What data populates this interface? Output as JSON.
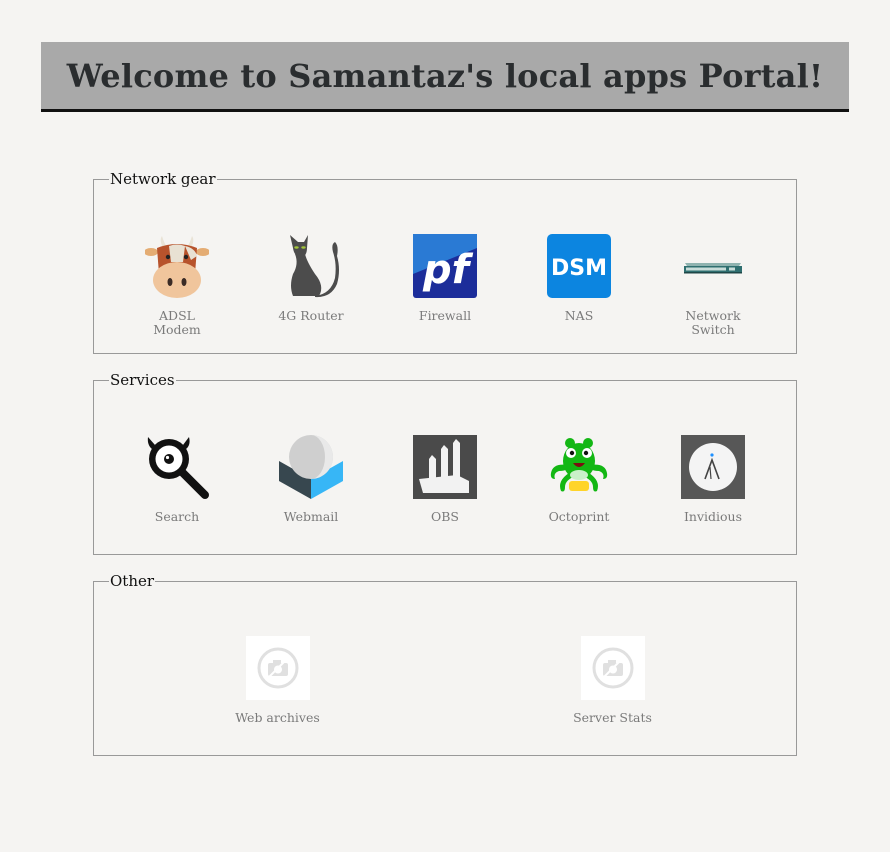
{
  "header": {
    "title": "Welcome to Samantaz's local apps Portal!"
  },
  "sections": [
    {
      "legend": "Network gear",
      "apps": [
        {
          "label": "ADSL Modem",
          "icon": "cow-icon"
        },
        {
          "label": "4G Router",
          "icon": "cat-icon"
        },
        {
          "label": "Firewall",
          "icon": "pfsense-icon"
        },
        {
          "label": "NAS",
          "icon": "dsm-icon"
        },
        {
          "label": "Network Switch",
          "icon": "switch-icon"
        }
      ]
    },
    {
      "legend": "Services",
      "apps": [
        {
          "label": "Search",
          "icon": "searx-icon"
        },
        {
          "label": "Webmail",
          "icon": "roundcube-icon"
        },
        {
          "label": "OBS",
          "icon": "obs-icon"
        },
        {
          "label": "Octoprint",
          "icon": "octoprint-icon"
        },
        {
          "label": "Invidious",
          "icon": "invidious-icon"
        }
      ]
    },
    {
      "legend": "Other",
      "apps": [
        {
          "label": "Web archives",
          "icon": "broken-image-icon"
        },
        {
          "label": "Server Stats",
          "icon": "broken-image-icon"
        }
      ]
    }
  ]
}
